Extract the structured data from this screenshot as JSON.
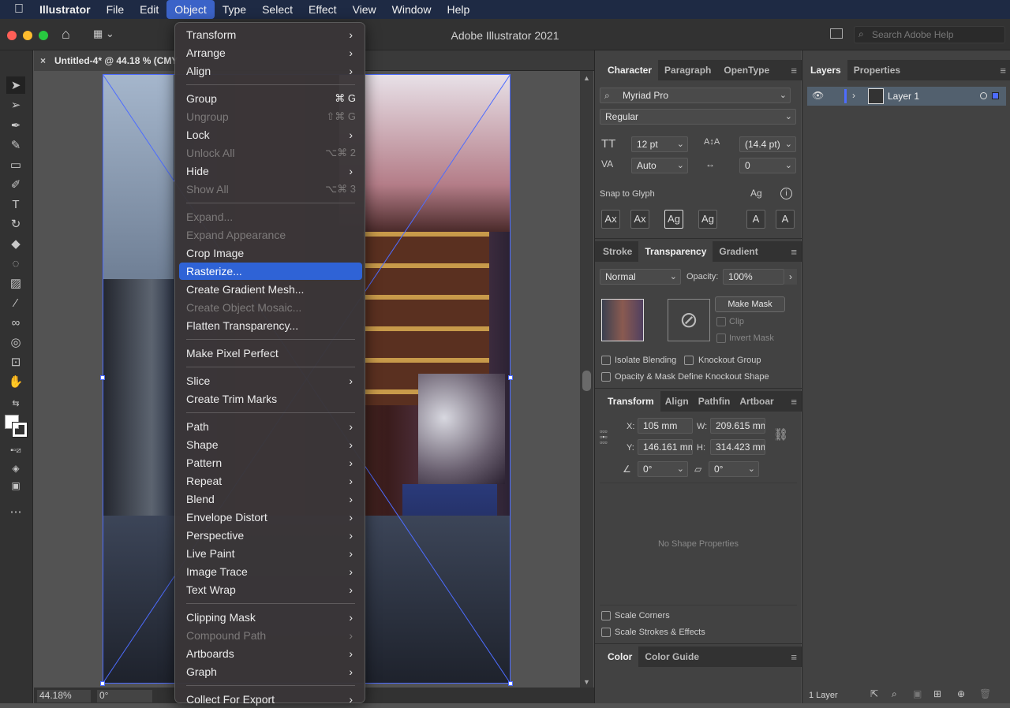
{
  "menubar": {
    "app": "Illustrator",
    "items": [
      "File",
      "Edit",
      "Object",
      "Type",
      "Select",
      "Effect",
      "View",
      "Window",
      "Help"
    ]
  },
  "window": {
    "title": "Adobe Illustrator 2021",
    "search_placeholder": "Search Adobe Help"
  },
  "document": {
    "tab": "Untitled-4* @ 44.18 % (CMY"
  },
  "status": {
    "zoom": "44.18%",
    "rotation": "0°"
  },
  "object_menu": [
    {
      "label": "Transform",
      "sub": true
    },
    {
      "label": "Arrange",
      "sub": true
    },
    {
      "label": "Align",
      "sub": true
    },
    {
      "sep": true
    },
    {
      "label": "Group",
      "shortcut": "⌘ G"
    },
    {
      "label": "Ungroup",
      "shortcut": "⇧⌘ G",
      "disabled": true
    },
    {
      "label": "Lock",
      "sub": true
    },
    {
      "label": "Unlock All",
      "shortcut": "⌥⌘ 2",
      "disabled": true
    },
    {
      "label": "Hide",
      "sub": true
    },
    {
      "label": "Show All",
      "shortcut": "⌥⌘ 3",
      "disabled": true
    },
    {
      "sep": true
    },
    {
      "label": "Expand...",
      "disabled": true
    },
    {
      "label": "Expand Appearance",
      "disabled": true
    },
    {
      "label": "Crop Image"
    },
    {
      "label": "Rasterize...",
      "highlighted": true
    },
    {
      "label": "Create Gradient Mesh..."
    },
    {
      "label": "Create Object Mosaic...",
      "disabled": true
    },
    {
      "label": "Flatten Transparency..."
    },
    {
      "sep": true
    },
    {
      "label": "Make Pixel Perfect"
    },
    {
      "sep": true
    },
    {
      "label": "Slice",
      "sub": true
    },
    {
      "label": "Create Trim Marks"
    },
    {
      "sep": true
    },
    {
      "label": "Path",
      "sub": true
    },
    {
      "label": "Shape",
      "sub": true
    },
    {
      "label": "Pattern",
      "sub": true
    },
    {
      "label": "Repeat",
      "sub": true
    },
    {
      "label": "Blend",
      "sub": true
    },
    {
      "label": "Envelope Distort",
      "sub": true
    },
    {
      "label": "Perspective",
      "sub": true
    },
    {
      "label": "Live Paint",
      "sub": true
    },
    {
      "label": "Image Trace",
      "sub": true
    },
    {
      "label": "Text Wrap",
      "sub": true
    },
    {
      "sep": true
    },
    {
      "label": "Clipping Mask",
      "sub": true
    },
    {
      "label": "Compound Path",
      "sub": true,
      "disabled": true
    },
    {
      "label": "Artboards",
      "sub": true
    },
    {
      "label": "Graph",
      "sub": true
    },
    {
      "sep": true
    },
    {
      "label": "Collect For Export",
      "sub": true
    }
  ],
  "character": {
    "tabs": [
      "Character",
      "Paragraph",
      "OpenType"
    ],
    "font": "Myriad Pro",
    "style": "Regular",
    "size": "12 pt",
    "leading": "(14.4 pt)",
    "kerning": "Auto",
    "tracking": "0",
    "snap_label": "Snap to Glyph"
  },
  "transparency": {
    "tabs": [
      "Stroke",
      "Transparency",
      "Gradient"
    ],
    "blend": "Normal",
    "opacity_label": "Opacity:",
    "opacity": "100%",
    "make_mask": "Make Mask",
    "clip": "Clip",
    "invert": "Invert Mask",
    "isolate": "Isolate Blending",
    "knockout": "Knockout Group",
    "opacity_mask": "Opacity & Mask Define Knockout Shape"
  },
  "transform": {
    "tabs": [
      "Transform",
      "Align",
      "Pathfin",
      "Artboar"
    ],
    "x_label": "X:",
    "x": "105 mm",
    "y_label": "Y:",
    "y": "146.161 mm",
    "w_label": "W:",
    "w": "209.615 mm",
    "h_label": "H:",
    "h": "314.423 mm",
    "rotate": "0°",
    "shear": "0°",
    "no_shape": "No Shape Properties",
    "scale_corners": "Scale Corners",
    "scale_strokes": "Scale Strokes & Effects"
  },
  "color": {
    "tabs": [
      "Color",
      "Color Guide"
    ]
  },
  "layers": {
    "tabs": [
      "Layers",
      "Properties"
    ],
    "layer_name": "Layer 1",
    "count": "1 Layer"
  }
}
